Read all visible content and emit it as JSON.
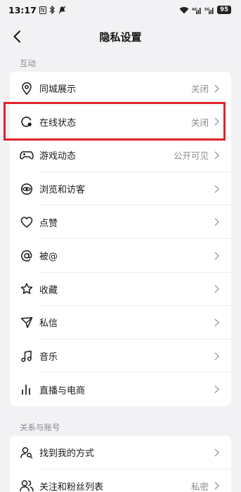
{
  "status_bar": {
    "time": "13:17",
    "left_icons": [
      "nfc-icon",
      "bluetooth-icon",
      "mute-icon"
    ],
    "right_icons": [
      "wifi-icon",
      "signal-4g-icon",
      "signal-5g-icon"
    ],
    "battery": "95"
  },
  "header": {
    "title": "隐私设置"
  },
  "sections": [
    {
      "title": "互动",
      "items": [
        {
          "label": "同城展示",
          "value": "关闭",
          "icon": "location-pin-icon"
        },
        {
          "label": "在线状态",
          "value": "关闭",
          "icon": "online-status-icon"
        },
        {
          "label": "游戏动态",
          "value": "公开可见",
          "icon": "gamepad-icon"
        },
        {
          "label": "浏览和访客",
          "value": "",
          "icon": "eye-icon"
        },
        {
          "label": "点赞",
          "value": "",
          "icon": "heart-icon"
        },
        {
          "label": "被@",
          "value": "",
          "icon": "at-icon"
        },
        {
          "label": "收藏",
          "value": "",
          "icon": "star-icon"
        },
        {
          "label": "私信",
          "value": "",
          "icon": "send-icon"
        },
        {
          "label": "音乐",
          "value": "",
          "icon": "music-note-icon"
        },
        {
          "label": "直播与电商",
          "value": "",
          "icon": "bar-chart-icon"
        }
      ]
    },
    {
      "title": "关系与账号",
      "items": [
        {
          "label": "找到我的方式",
          "value": "",
          "icon": "user-search-icon"
        },
        {
          "label": "关注和粉丝列表",
          "value": "私密",
          "icon": "users-icon"
        }
      ]
    }
  ],
  "colors": {
    "background": "#f2f2f4",
    "card": "#ffffff",
    "highlight_border": "#e0222a",
    "secondary_text": "#8a8a8f"
  }
}
